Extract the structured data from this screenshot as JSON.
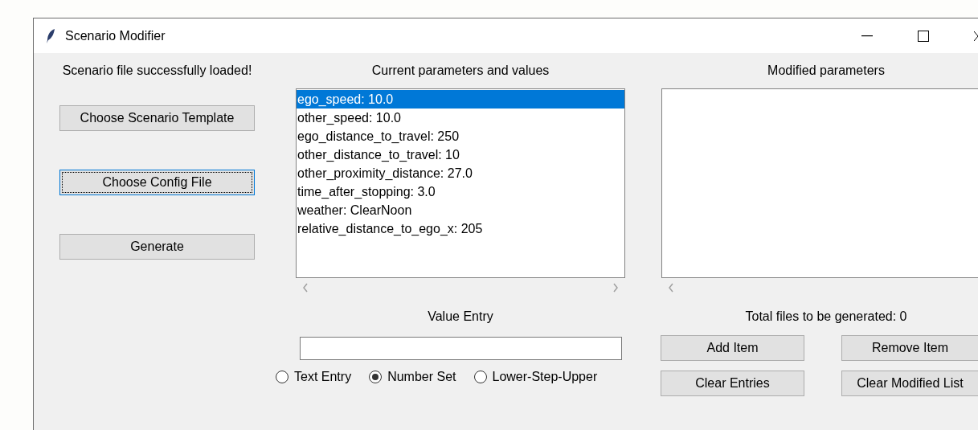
{
  "window": {
    "title": "Scenario Modifier"
  },
  "status_message": "Scenario file successfully loaded!",
  "left_buttons": [
    {
      "label": "Choose Scenario Template",
      "focused": false
    },
    {
      "label": "Choose Config File",
      "focused": true
    },
    {
      "label": "Generate",
      "focused": false
    }
  ],
  "current_parameters": {
    "title": "Current parameters and values",
    "items": [
      {
        "text": "ego_speed: 10.0",
        "selected": true
      },
      {
        "text": "other_speed: 10.0",
        "selected": false
      },
      {
        "text": "ego_distance_to_travel: 250",
        "selected": false
      },
      {
        "text": "other_distance_to_travel: 10",
        "selected": false
      },
      {
        "text": "other_proximity_distance: 27.0",
        "selected": false
      },
      {
        "text": "time_after_stopping: 3.0",
        "selected": false
      },
      {
        "text": "weather: ClearNoon",
        "selected": false
      },
      {
        "text": "relative_distance_to_ego_x: 205",
        "selected": false
      }
    ]
  },
  "modified_parameters": {
    "title": "Modified parameters"
  },
  "value_entry": {
    "label": "Value Entry"
  },
  "entry_modes": [
    {
      "label": "Text Entry",
      "selected": false
    },
    {
      "label": "Number Set",
      "selected": true
    },
    {
      "label": "Lower-Step-Upper",
      "selected": false
    }
  ],
  "total_files": "Total files to be generated: 0",
  "action_buttons": [
    "Add Item",
    "Remove Item",
    "Clear Entries",
    "Clear Modified List"
  ]
}
